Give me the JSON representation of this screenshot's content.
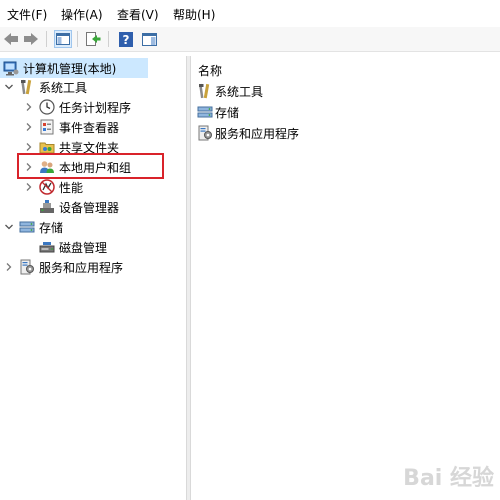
{
  "menu": {
    "items": [
      "文件(F)",
      "操作(A)",
      "查看(V)",
      "帮助(H)"
    ]
  },
  "toolbar": {
    "buttons": [
      "back-arrow-icon",
      "forward-arrow-icon",
      "show-hide-console-tree-icon",
      "export-list-icon",
      "help-icon",
      "action-pane-icon"
    ]
  },
  "tree": {
    "root": "计算机管理(本地)",
    "system_tools": "系统工具",
    "task_scheduler": "任务计划程序",
    "event_viewer": "事件查看器",
    "shared_folders": "共享文件夹",
    "local_users_groups": "本地用户和组",
    "performance": "性能",
    "device_manager": "设备管理器",
    "storage": "存储",
    "disk_management": "磁盘管理",
    "services_apps": "服务和应用程序"
  },
  "right_pane": {
    "column_header": "名称",
    "items": [
      "系统工具",
      "存储",
      "服务和应用程序"
    ]
  },
  "watermark": "Bai 经验",
  "colors": {
    "selection": "#cce8ff",
    "highlight_border": "#d9232a"
  }
}
